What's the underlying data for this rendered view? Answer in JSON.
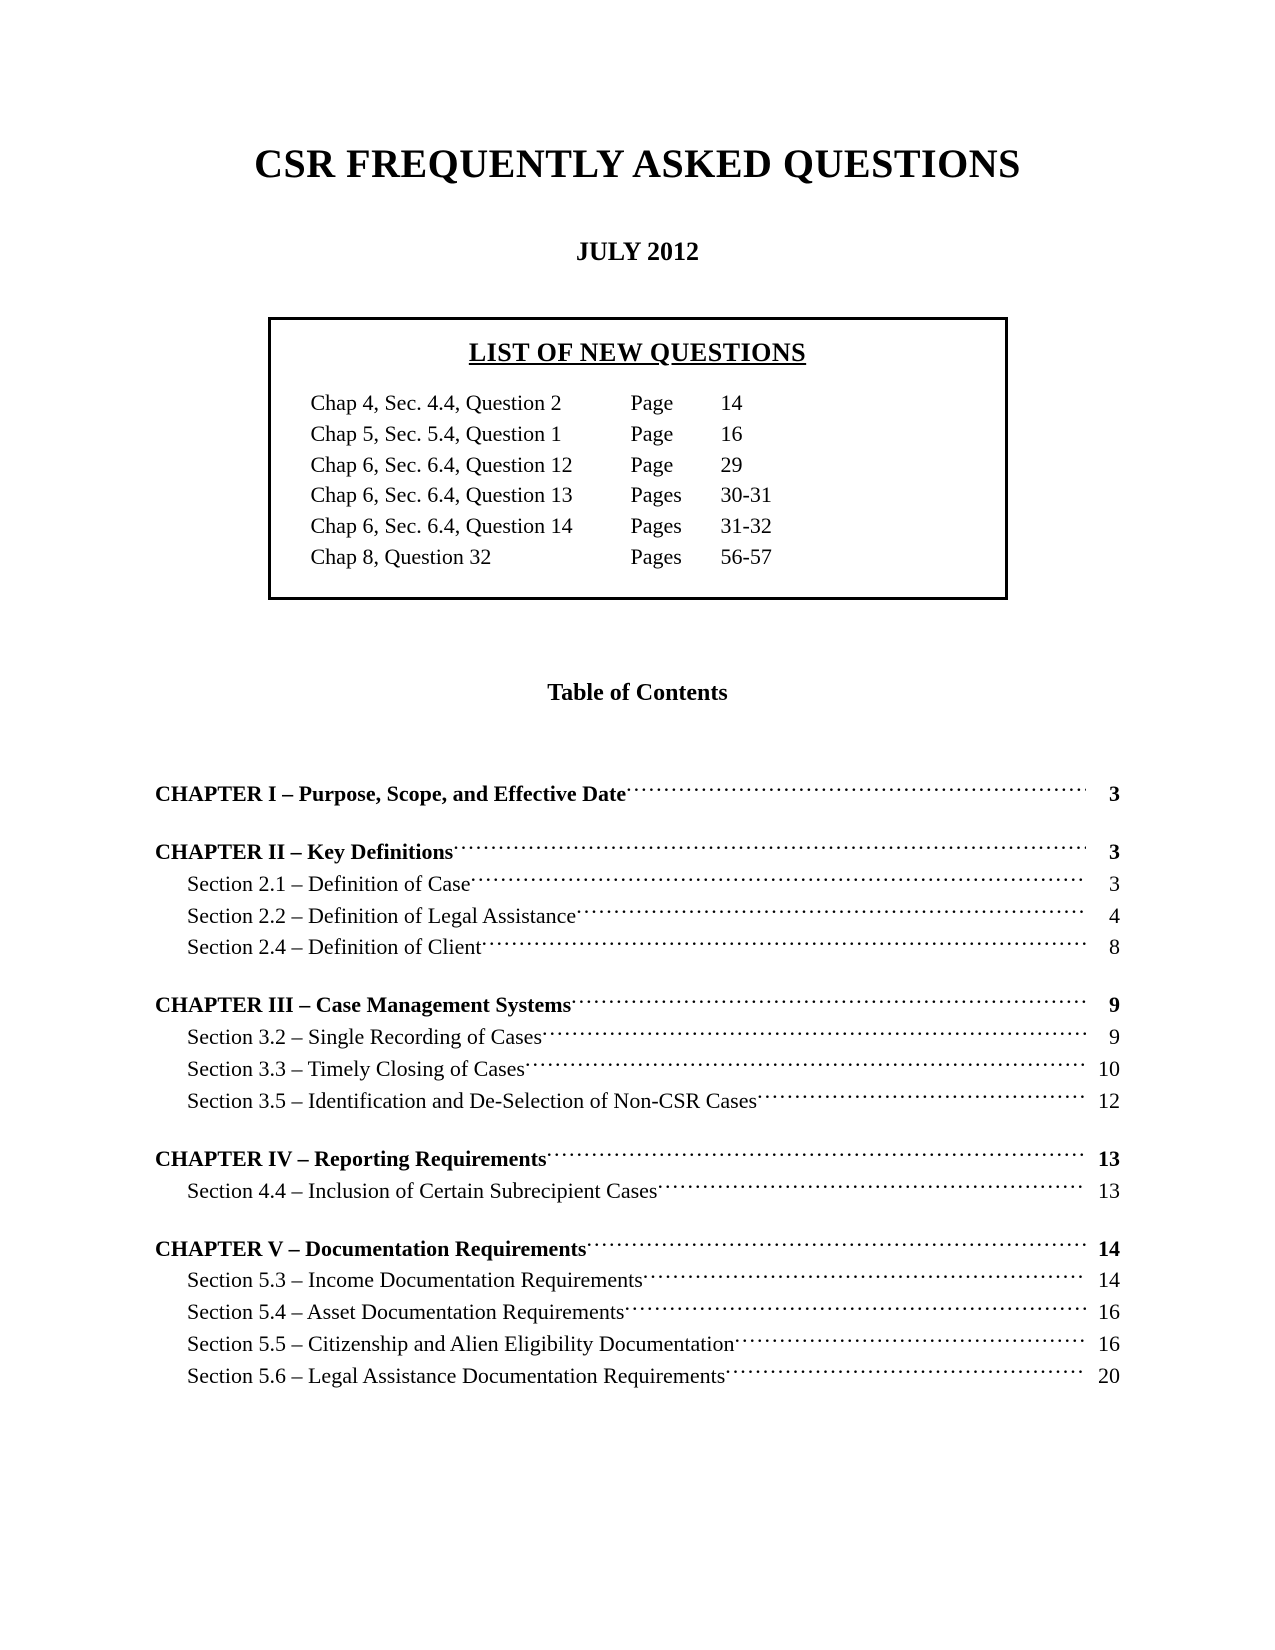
{
  "title": "CSR FREQUENTLY ASKED QUESTIONS",
  "subtitle": "JULY 2012",
  "new_questions": {
    "heading": "LIST OF NEW QUESTIONS",
    "rows": [
      {
        "label": "Chap 4, Sec. 4.4, Question 2",
        "page_word": "Page",
        "page_num": "14"
      },
      {
        "label": "Chap 5, Sec. 5.4, Question 1",
        "page_word": "Page",
        "page_num": "16"
      },
      {
        "label": "Chap 6, Sec. 6.4, Question 12",
        "page_word": "Page",
        "page_num": "29"
      },
      {
        "label": "Chap 6, Sec. 6.4, Question 13",
        "page_word": "Pages",
        "page_num": "30-31"
      },
      {
        "label": "Chap 6, Sec. 6.4, Question 14",
        "page_word": "Pages",
        "page_num": "31-32"
      },
      {
        "label": "Chap 8, Question 32",
        "page_word": "Pages",
        "page_num": "56-57"
      }
    ]
  },
  "toc": {
    "heading": "Table of Contents",
    "blocks": [
      {
        "chapter": {
          "label": "CHAPTER I – Purpose, Scope, and Effective Date",
          "page": "3"
        },
        "sections": []
      },
      {
        "chapter": {
          "label": "CHAPTER II – Key Definitions",
          "page": "3"
        },
        "sections": [
          {
            "label": "Section 2.1 – Definition of Case",
            "page": "3"
          },
          {
            "label": "Section 2.2 – Definition of Legal Assistance",
            "page": "4"
          },
          {
            "label": "Section 2.4 – Definition of Client",
            "page": "8"
          }
        ]
      },
      {
        "chapter": {
          "label": "CHAPTER III – Case Management Systems",
          "page": "9"
        },
        "sections": [
          {
            "label": "Section 3.2 – Single Recording of Cases",
            "page": "9"
          },
          {
            "label": "Section 3.3 – Timely Closing of Cases",
            "page": "10"
          },
          {
            "label": "Section 3.5 – Identification and De-Selection of Non-CSR Cases",
            "page": "12"
          }
        ]
      },
      {
        "chapter": {
          "label": "CHAPTER IV – Reporting Requirements",
          "page": "13"
        },
        "sections": [
          {
            "label": "Section 4.4 – Inclusion of Certain Subrecipient Cases",
            "page": "13"
          }
        ]
      },
      {
        "chapter": {
          "label": "CHAPTER V – Documentation Requirements",
          "page": "14"
        },
        "sections": [
          {
            "label": "Section 5.3 – Income Documentation Requirements",
            "page": "14"
          },
          {
            "label": "Section 5.4 – Asset Documentation Requirements",
            "page": "16"
          },
          {
            "label": "Section 5.5 – Citizenship and Alien Eligibility Documentation",
            "page": "16"
          },
          {
            "label": "Section 5.6 – Legal Assistance Documentation Requirements ",
            "page": "20"
          }
        ]
      }
    ]
  }
}
